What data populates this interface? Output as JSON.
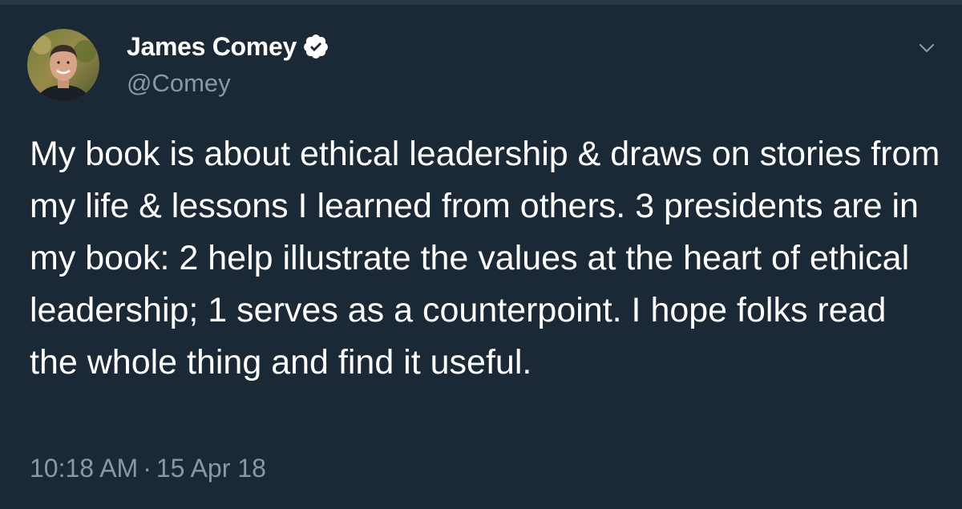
{
  "tweet": {
    "author": {
      "display_name": "James Comey",
      "handle": "@Comey",
      "verified": true,
      "avatar_icon": "profile-photo"
    },
    "text": "My book is about ethical leadership & draws on stories from my life & lessons I learned from others. 3 presidents are in my book: 2 help illustrate the values at the heart of ethical leadership; 1 serves as a counterpoint. I hope folks read the whole thing and find it useful.",
    "time": "10:18 AM",
    "separator": "·",
    "date": "15 Apr 18",
    "menu_icon": "chevron-down-icon"
  },
  "colors": {
    "background": "#1b2836",
    "text": "#ffffff",
    "secondary_text": "#8899a6",
    "verified_badge": "#ffffff"
  }
}
